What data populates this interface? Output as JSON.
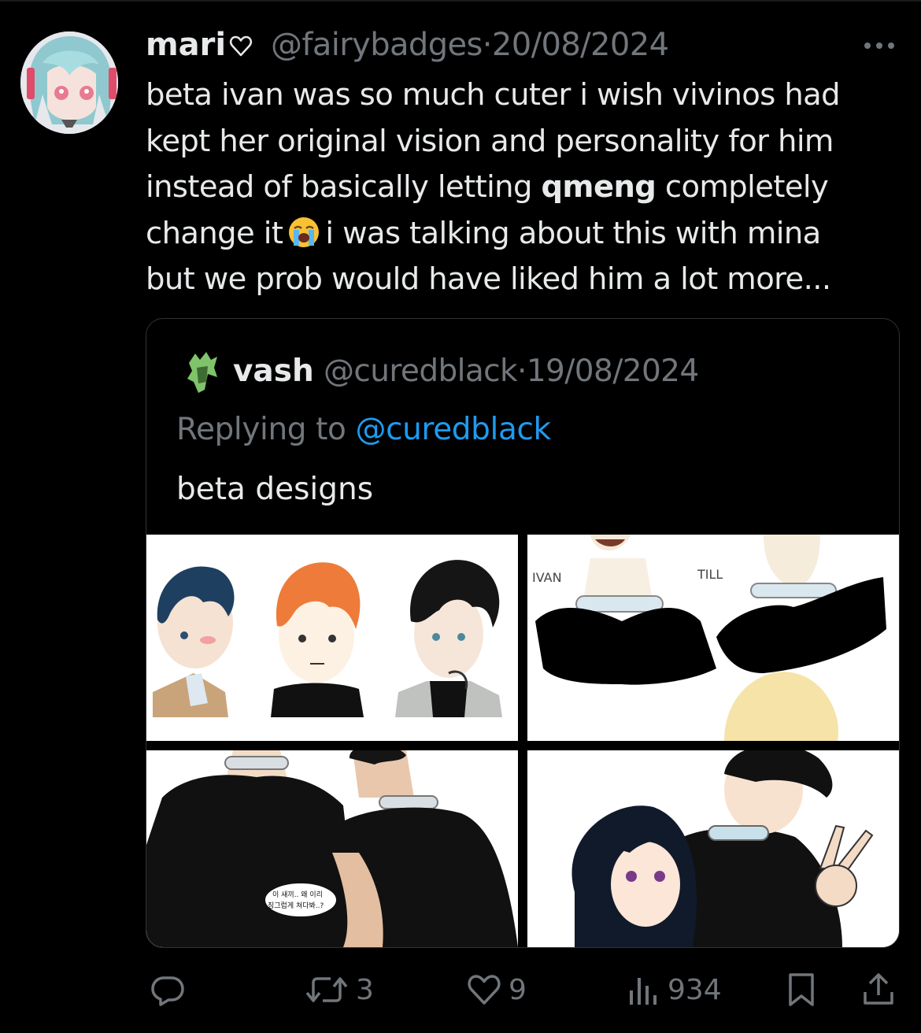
{
  "post": {
    "display_name": "mari",
    "handle": "@fairybadges",
    "dot": "·",
    "date": "20/08/2024",
    "lines": [
      {
        "segments": [
          {
            "text": "beta ivan was so much cuter i wish vivinos had"
          }
        ]
      },
      {
        "segments": [
          {
            "text": "kept her original vision and personality for him"
          }
        ]
      },
      {
        "segments": [
          {
            "text": "instead of basically letting "
          },
          {
            "text": "qmeng",
            "bold": true
          },
          {
            "text": " completely"
          }
        ]
      },
      {
        "segments": [
          {
            "text": "change it"
          },
          {
            "emoji": "loudly-crying-face"
          },
          {
            "text": "i was talking about this with mina"
          }
        ]
      },
      {
        "segments": [
          {
            "text": "but we prob would have liked him a lot more..."
          }
        ]
      }
    ]
  },
  "quote": {
    "display_name": "vash",
    "handle": "@curedblack",
    "dot": "·",
    "date": "19/08/2024",
    "replying_prefix": "Replying to ",
    "replying_mention": "@curedblack",
    "text": "beta designs",
    "images": [
      {
        "name": "three-character-heads"
      },
      {
        "name": "ivan-and-till-collars",
        "labels": [
          "IVAN",
          "TILL"
        ]
      },
      {
        "name": "two-characters-smoking",
        "speech": [
          "이 새끼.. 왜 이리",
          "징그럽게 쳐다봐..?"
        ]
      },
      {
        "name": "couple-peace-sign"
      }
    ]
  },
  "actions": {
    "reply": {
      "icon": "reply-icon",
      "count": ""
    },
    "repost": {
      "icon": "repost-icon",
      "count": "3"
    },
    "like": {
      "icon": "heart-icon",
      "count": "9"
    },
    "views": {
      "icon": "views-icon",
      "count": "934"
    },
    "bookmark": {
      "icon": "bookmark-icon"
    },
    "share": {
      "icon": "share-icon"
    }
  },
  "colors": {
    "background": "#000000",
    "text": "#e7e9ea",
    "muted": "#71767b",
    "link": "#1d9bf0",
    "border": "#2f3336"
  }
}
